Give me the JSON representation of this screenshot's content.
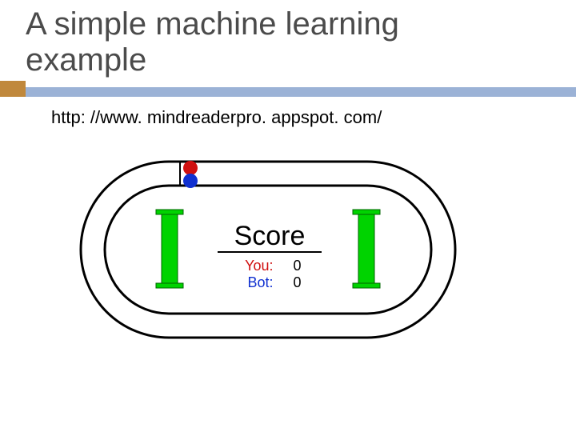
{
  "title_line1": "A simple machine learning",
  "title_line2": "example",
  "url": "http: //www. mindreaderpro. appspot. com/",
  "score": {
    "heading": "Score",
    "you_label": "You:",
    "you_value": "0",
    "bot_label": "Bot:",
    "bot_value": "0"
  },
  "colors": {
    "you": "#d01010",
    "bot": "#1030d0",
    "pillar": "#00d300",
    "accent_bar": "#9bb2d6",
    "accent_chip": "#c0883c"
  }
}
